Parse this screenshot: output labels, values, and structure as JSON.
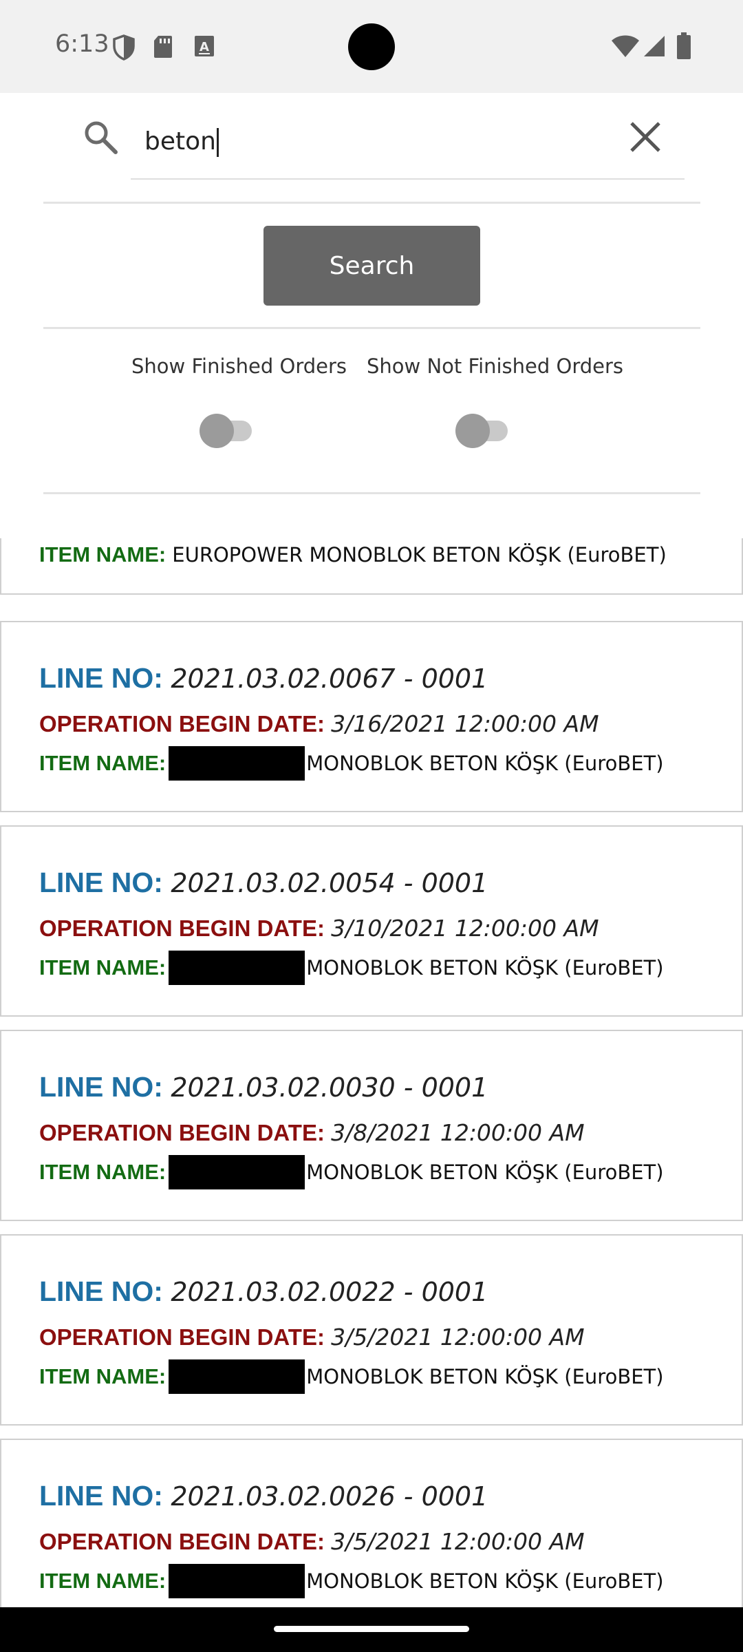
{
  "status_bar": {
    "time": "6:13",
    "left_icons": [
      "shield-icon",
      "sd-card-icon",
      "keyboard-a-icon"
    ],
    "right_icons": [
      "wifi-icon",
      "cellular-signal-icon",
      "battery-icon"
    ]
  },
  "search": {
    "query": "beton",
    "button_label": "Search"
  },
  "filters": {
    "finished_label": "Show Finished Orders",
    "finished_on": false,
    "not_finished_label": "Show Not Finished Orders",
    "not_finished_on": false
  },
  "labels": {
    "line_no": "LINE NO:",
    "operation_begin_date": "OPERATION BEGIN DATE:",
    "item_name": "ITEM NAME:"
  },
  "partial_item": {
    "item_name": "EUROPOWER MONOBLOK BETON KÖŞK (EuroBET)"
  },
  "orders": [
    {
      "line_no": "2021.03.02.0067 - 0001",
      "begin_date": "3/16/2021 12:00:00 AM",
      "item_name": "MONOBLOK BETON KÖŞK (EuroBET)"
    },
    {
      "line_no": "2021.03.02.0054 - 0001",
      "begin_date": "3/10/2021 12:00:00 AM",
      "item_name": "MONOBLOK BETON KÖŞK (EuroBET)"
    },
    {
      "line_no": "2021.03.02.0030 - 0001",
      "begin_date": "3/8/2021 12:00:00 AM",
      "item_name": "MONOBLOK BETON KÖŞK (EuroBET)"
    },
    {
      "line_no": "2021.03.02.0022 - 0001",
      "begin_date": "3/5/2021 12:00:00 AM",
      "item_name": "MONOBLOK BETON KÖŞK (EuroBET)"
    },
    {
      "line_no": "2021.03.02.0026 - 0001",
      "begin_date": "3/5/2021 12:00:00 AM",
      "item_name": "MONOBLOK BETON KÖŞK (EuroBET)"
    }
  ],
  "colors": {
    "line_no_label": "#1e6fa3",
    "date_label": "#8b0f0f",
    "item_label": "#136b13",
    "button_bg": "#666666"
  }
}
